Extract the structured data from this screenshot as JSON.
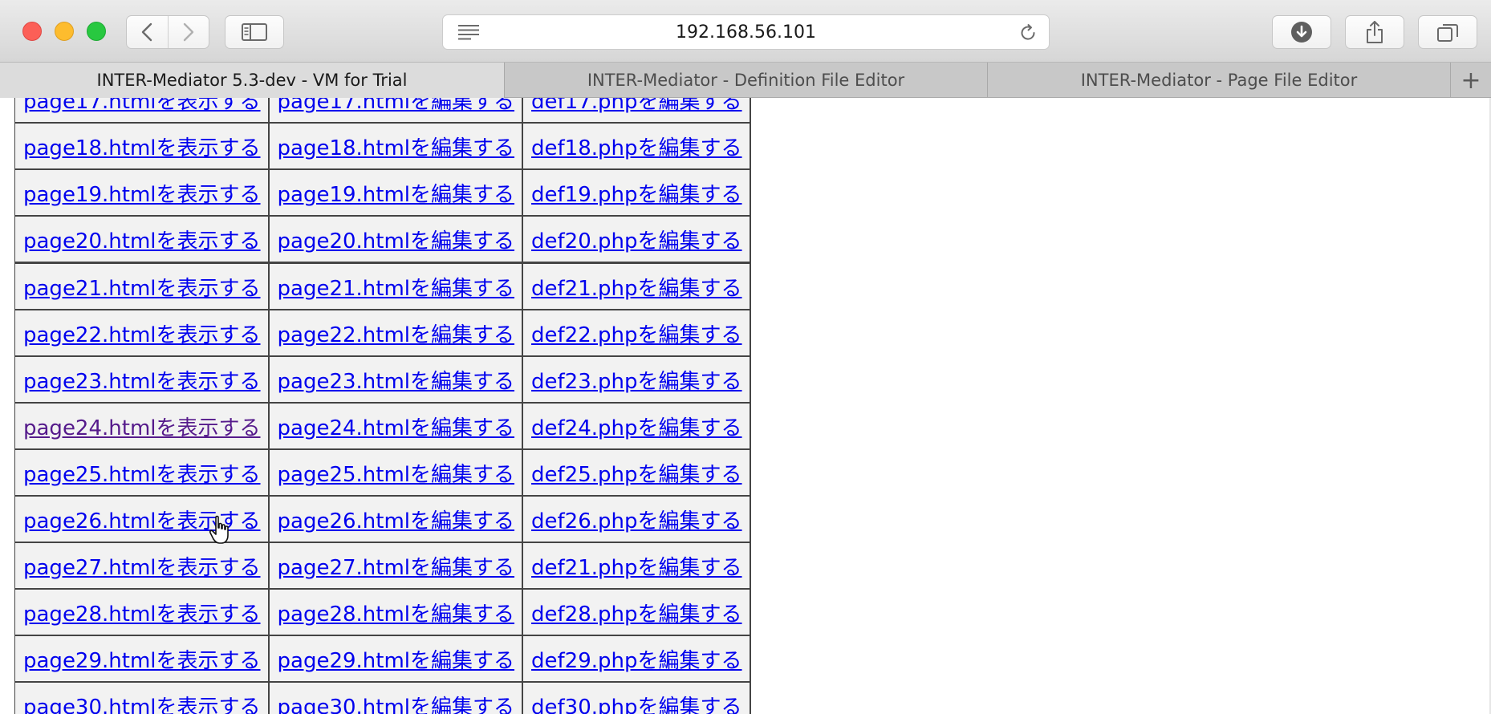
{
  "window": {
    "url": "192.168.56.101"
  },
  "tabs": [
    {
      "label": "INTER-Mediator 5.3-dev - VM for Trial",
      "active": true
    },
    {
      "label": "INTER-Mediator - Definition File Editor",
      "active": false
    },
    {
      "label": "INTER-Mediator - Page File Editor",
      "active": false
    }
  ],
  "new_tab_label": "+",
  "icons": {
    "close": "close-icon",
    "minimize": "minimize-icon",
    "maximize": "maximize-icon",
    "back": "chevron-left-icon",
    "forward": "chevron-right-icon",
    "sidebar": "sidebar-icon",
    "reader": "reader-lines-icon",
    "reload": "reload-icon",
    "download": "download-icon",
    "share": "share-icon",
    "tabs": "tabs-overview-icon",
    "cursor": "hand-pointer-icon"
  },
  "colors": {
    "link": "#0000ee",
    "visited": "#551a8b"
  },
  "rows": [
    {
      "view": "page17.htmlを表示する",
      "edit": "page17.htmlを編集する",
      "def": "def17.phpを編集する"
    },
    {
      "view": "page18.htmlを表示する",
      "edit": "page18.htmlを編集する",
      "def": "def18.phpを編集する"
    },
    {
      "view": "page19.htmlを表示する",
      "edit": "page19.htmlを編集する",
      "def": "def19.phpを編集する"
    },
    {
      "view": "page20.htmlを表示する",
      "edit": "page20.htmlを編集する",
      "def": "def20.phpを編集する"
    },
    {
      "view": "page21.htmlを表示する",
      "edit": "page21.htmlを編集する",
      "def": "def21.phpを編集する"
    },
    {
      "view": "page22.htmlを表示する",
      "edit": "page22.htmlを編集する",
      "def": "def22.phpを編集する"
    },
    {
      "view": "page23.htmlを表示する",
      "edit": "page23.htmlを編集する",
      "def": "def23.phpを編集する"
    },
    {
      "view": "page24.htmlを表示する",
      "edit": "page24.htmlを編集する",
      "def": "def24.phpを編集する"
    },
    {
      "view": "page25.htmlを表示する",
      "edit": "page25.htmlを編集する",
      "def": "def25.phpを編集する"
    },
    {
      "view": "page26.htmlを表示する",
      "edit": "page26.htmlを編集する",
      "def": "def26.phpを編集する"
    },
    {
      "view": "page27.htmlを表示する",
      "edit": "page27.htmlを編集する",
      "def": "def21.phpを編集する"
    },
    {
      "view": "page28.htmlを表示する",
      "edit": "page28.htmlを編集する",
      "def": "def28.phpを編集する"
    },
    {
      "view": "page29.htmlを表示する",
      "edit": "page29.htmlを編集する",
      "def": "def29.phpを編集する"
    },
    {
      "view": "page30.htmlを表示する",
      "edit": "page30.htmlを編集する",
      "def": "def30.phpを編集する"
    }
  ]
}
